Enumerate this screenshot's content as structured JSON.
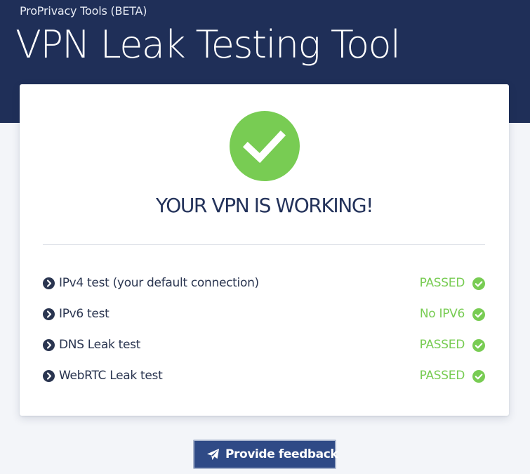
{
  "header": {
    "brand": "ProPrivacy Tools (BETA)",
    "title": "VPN Leak Testing Tool",
    "background": "#1f2f58"
  },
  "result": {
    "status_icon": "check-circle-icon",
    "heading": "YOUR VPN IS WORKING!",
    "accent": "#78cc53"
  },
  "tests": [
    {
      "name": "IPv4 test (your default connection)",
      "status": "PASSED",
      "icon": "check-circle-icon"
    },
    {
      "name": "IPv6 test",
      "status": "No IPV6",
      "icon": "check-circle-icon"
    },
    {
      "name": "DNS Leak test",
      "status": "PASSED",
      "icon": "check-circle-icon"
    },
    {
      "name": "WebRTC Leak test",
      "status": "PASSED",
      "icon": "check-circle-icon"
    }
  ],
  "feedback": {
    "label": "Provide feedback",
    "icon": "paper-plane-icon",
    "color": "#2f4a86"
  }
}
